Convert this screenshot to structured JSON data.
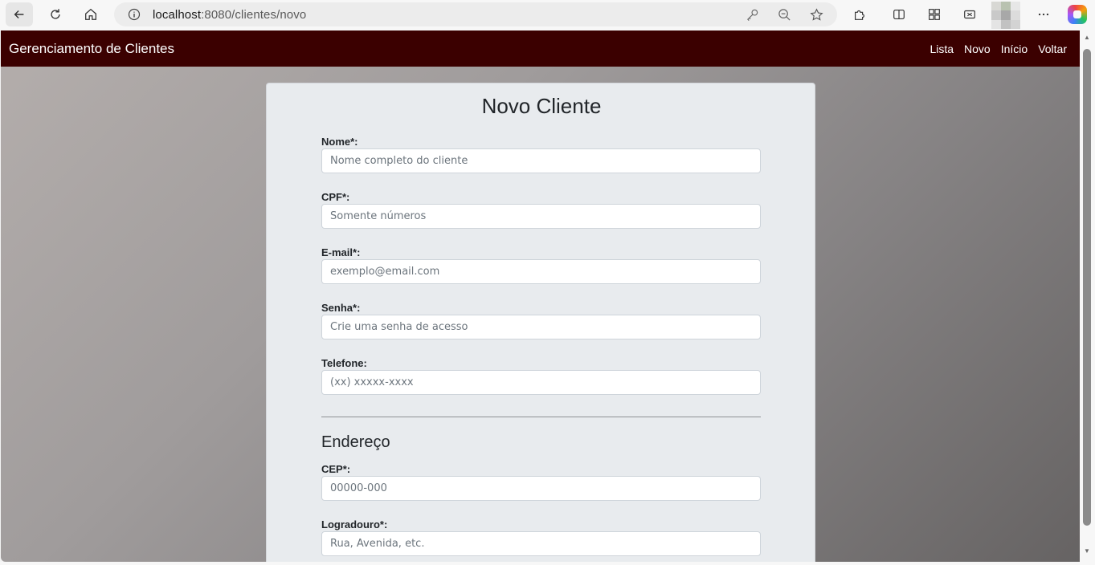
{
  "browser": {
    "url_host": "localhost",
    "url_rest": ":8080/clientes/novo"
  },
  "app": {
    "brand": "Gerenciamento de Clientes",
    "nav": [
      "Lista",
      "Novo",
      "Início",
      "Voltar"
    ]
  },
  "form": {
    "title": "Novo Cliente",
    "fields": [
      {
        "label": "Nome*:",
        "placeholder": "Nome completo do cliente",
        "value": ""
      },
      {
        "label": "CPF*:",
        "placeholder": "Somente números",
        "value": ""
      },
      {
        "label": "E-mail*:",
        "placeholder": "exemplo@email.com",
        "value": ""
      },
      {
        "label": "Senha*:",
        "placeholder": "Crie uma senha de acesso",
        "value": ""
      },
      {
        "label": "Telefone:",
        "placeholder": "(xx) xxxxx-xxxx",
        "value": ""
      }
    ],
    "address_title": "Endereço",
    "address_fields": [
      {
        "label": "CEP*:",
        "placeholder": "00000-000",
        "value": ""
      },
      {
        "label": "Logradouro*:",
        "placeholder": "Rua, Avenida, etc.",
        "value": ""
      }
    ]
  },
  "colors": {
    "navbar": "#3b0000",
    "card": "#e8ebee",
    "accent_text": "#212529"
  }
}
